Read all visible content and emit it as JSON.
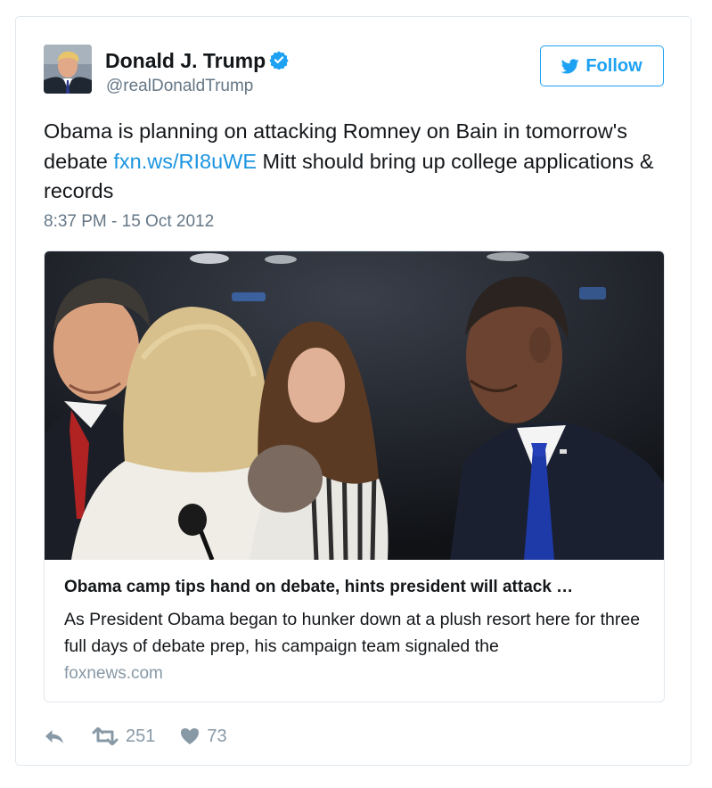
{
  "author": {
    "display_name": "Donald J. Trump",
    "screen_name": "@realDonaldTrump",
    "verified_icon": "verified-badge-icon",
    "avatar_icon": "profile-photo"
  },
  "follow_button": {
    "label": "Follow",
    "icon": "twitter-bird-icon"
  },
  "tweet": {
    "text_part1": "Obama is planning on attacking Romney on Bain in tomorrow's debate ",
    "link_text": "fxn.ws/RI8uWE",
    "text_part2": " Mitt should bring up college applications & records",
    "timestamp": "8:37 PM - 15 Oct 2012"
  },
  "card": {
    "image_icon": "debate-photo",
    "title": "Obama camp tips hand on debate, hints president will attack …",
    "description": "As President Obama began to hunker down at a plush resort here for three full days of debate prep, his campaign team signaled the",
    "domain": "foxnews.com"
  },
  "actions": {
    "reply_icon": "reply-icon",
    "retweet_icon": "retweet-icon",
    "retweet_count": "251",
    "like_icon": "heart-icon",
    "like_count": "73"
  },
  "colors": {
    "accent": "#1da1f2",
    "link": "#1b95e0",
    "secondary_text": "#657786",
    "action_gray": "#8899a6",
    "border": "#e1e8ed"
  }
}
